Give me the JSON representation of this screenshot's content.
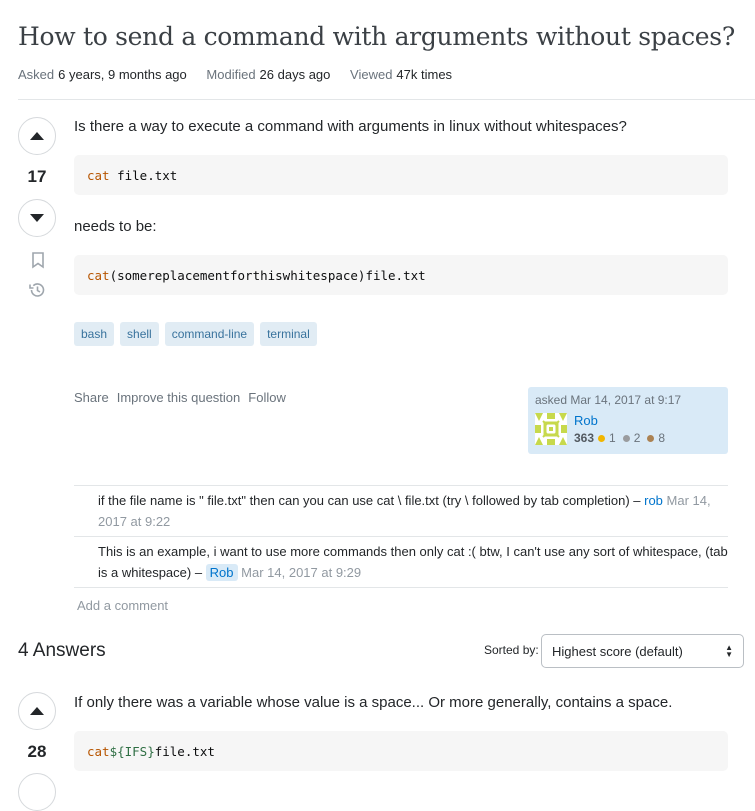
{
  "question": {
    "title": "How to send a command with arguments without spaces?",
    "meta": {
      "asked_label": "Asked",
      "asked_value": "6 years, 9 months ago",
      "modified_label": "Modified",
      "modified_value": "26 days ago",
      "viewed_label": "Viewed",
      "viewed_value": "47k times"
    },
    "score": "17",
    "body": {
      "p1": "Is there a way to execute a command with arguments in linux without whitespaces?",
      "code1_kw": "cat",
      "code1_rest": " file.txt",
      "p2": "needs to be:",
      "code2_kw": "cat",
      "code2_rest": "(somereplacementforthiswhitespace)file.txt"
    },
    "tags": [
      "bash",
      "shell",
      "command-line",
      "terminal"
    ],
    "post_menu": {
      "share": "Share",
      "improve": "Improve this question",
      "follow": "Follow"
    },
    "user_card": {
      "time": "asked Mar 14, 2017 at 9:17",
      "name": "Rob",
      "reputation": "363",
      "gold": "1",
      "silver": "2",
      "bronze": "8",
      "colors": {
        "gold": "#f1b600",
        "silver": "#9a9c9f",
        "bronze": "#ab8253",
        "identicon": "#c7d94c"
      }
    },
    "comments": [
      {
        "text": "if the file name is \" file.txt\" then can you can use cat \\ file.txt (try \\ followed by tab completion) – ",
        "user": "rob",
        "date": "Mar 14, 2017 at 9:22"
      },
      {
        "text": "This is an example, i want to use more commands then only cat :( btw, I can't use any sort of whitespace, (tab is a whitespace) – ",
        "user": "Rob",
        "date": "Mar 14, 2017 at 9:29"
      }
    ],
    "add_comment": "Add a comment"
  },
  "answers": {
    "count_label": "4 Answers",
    "sorted_by_label": "Sorted by:",
    "sort_value": "Highest score (default)",
    "first": {
      "score": "28",
      "p1": "If only there was a variable whose value is a space... Or more generally, contains a space.",
      "code_kw": "cat",
      "code_var": "${IFS}",
      "code_rest": "file.txt"
    }
  },
  "icons": {
    "upvote": "arrow-up-icon",
    "downvote": "arrow-down-icon",
    "bookmark": "bookmark-icon",
    "history": "history-icon",
    "sort": "chevron-updown-icon"
  }
}
